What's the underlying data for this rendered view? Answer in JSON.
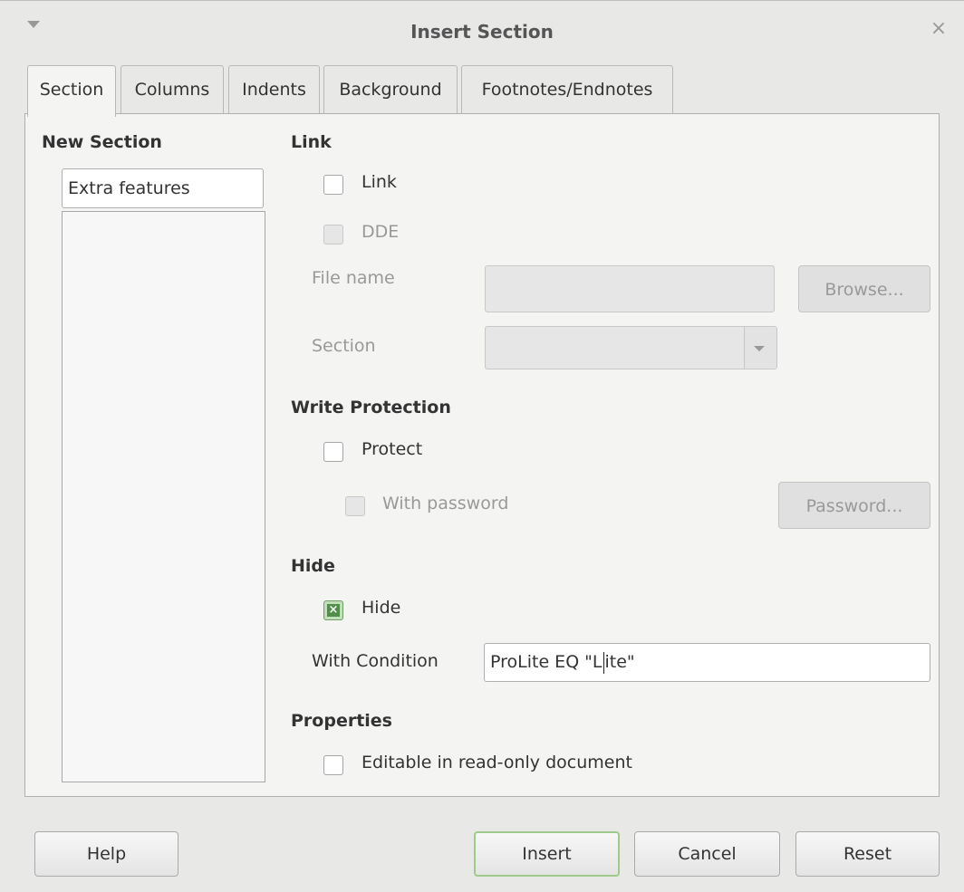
{
  "window": {
    "title": "Insert Section",
    "menu_icon": "chevron-down-icon",
    "close_glyph": "×"
  },
  "tabs": [
    {
      "label": "Section",
      "active": true
    },
    {
      "label": "Columns"
    },
    {
      "label": "Indents"
    },
    {
      "label": "Background"
    },
    {
      "label": "Footnotes/Endnotes"
    }
  ],
  "new_section": {
    "heading": "New Section",
    "name_value": "Extra features",
    "list_items": []
  },
  "link": {
    "heading": "Link",
    "link_label": "Link",
    "link_checked": false,
    "dde_label": "DDE",
    "dde_checked": false,
    "file_name_label": "File name",
    "file_name_value": "",
    "browse_label": "Browse...",
    "section_label": "Section",
    "section_value": ""
  },
  "write_protection": {
    "heading": "Write Protection",
    "protect_label": "Protect",
    "protect_checked": false,
    "with_password_label": "With password",
    "with_password_checked": false,
    "password_button": "Password..."
  },
  "hide": {
    "heading": "Hide",
    "hide_label": "Hide",
    "hide_checked": true,
    "condition_label": "With Condition",
    "condition_before_caret": "ProLite EQ \"L",
    "condition_after_caret": "ite\""
  },
  "properties": {
    "heading": "Properties",
    "editable_label": "Editable in read-only document",
    "editable_checked": false
  },
  "buttons": {
    "help": "Help",
    "insert": "Insert",
    "cancel": "Cancel",
    "reset": "Reset"
  },
  "colors": {
    "checked_green": "#4f8f47",
    "default_button_border": "#9fca8c"
  }
}
